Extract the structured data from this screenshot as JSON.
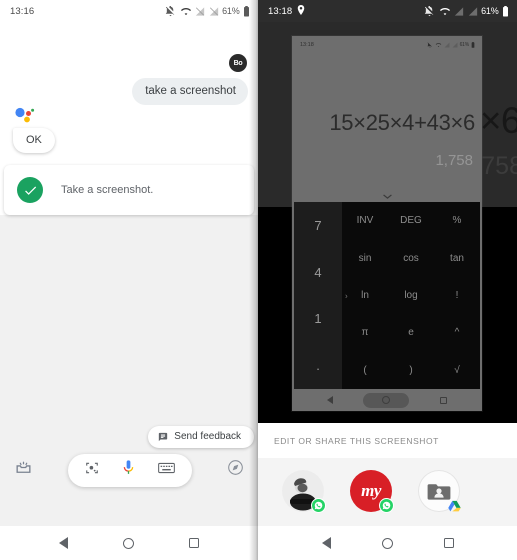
{
  "left_panel": {
    "status_bar": {
      "time": "13:16",
      "battery": "61%",
      "icons": [
        "notifications-off-icon",
        "wifi-icon",
        "signal-off-icon",
        "signal-off-icon",
        "battery-icon"
      ]
    },
    "avatar": {
      "initials": "Bo",
      "name": "account-avatar"
    },
    "user_message": "take a screenshot",
    "assistant_reply": "OK",
    "result_card": {
      "text": "Take a screenshot.",
      "status": "success",
      "accent_color": "#1aa260"
    },
    "feedback_chip": {
      "label": "Send feedback",
      "icon": "feedback-icon"
    },
    "input_bar": {
      "lens_icon": "google-lens-icon",
      "mic_icon": "microphone-icon",
      "keyboard_icon": "keyboard-icon",
      "snapshot_icon": "snapshot-inbox-icon",
      "explore_icon": "compass-explore-icon"
    },
    "nav_bar": {
      "back": "back-icon",
      "home": "home-icon",
      "recents": "recents-icon"
    }
  },
  "right_panel": {
    "status_bar": {
      "time": "13:18",
      "battery": "61%",
      "location_icon": "location-pin-icon",
      "icons": [
        "notifications-off-icon",
        "wifi-icon",
        "signal-off-icon",
        "signal-off-icon",
        "battery-icon"
      ]
    },
    "screenshot_preview": {
      "status_bar": {
        "time": "13:18",
        "battery": "61%"
      },
      "calculator": {
        "expression": "15×25×4+43×6",
        "result": "1,758",
        "expander_icon": "chevron-down-icon",
        "number_column": [
          "7",
          "4",
          "1",
          "."
        ],
        "scientific_rows": [
          [
            "INV",
            "DEG",
            "%"
          ],
          [
            "sin",
            "cos",
            "tan"
          ],
          [
            "ln",
            "log",
            "!"
          ],
          [
            "π",
            "e",
            "^"
          ],
          [
            "(",
            ")",
            "√"
          ]
        ],
        "pager_arrow": "›"
      },
      "nav_bar": {
        "back": "back-icon",
        "home": "home-icon",
        "recents": "recents-icon"
      }
    },
    "background_calculator": {
      "expression_tail": "×6",
      "result_tail": "758"
    },
    "share_sheet": {
      "title": "EDIT OR SHARE THIS SCREENSHOT",
      "targets": [
        {
          "name": "whatsapp-contact",
          "label": "",
          "badge": "whatsapp-badge"
        },
        {
          "name": "makemytrip-contact",
          "label": "my",
          "badge": "whatsapp-badge"
        },
        {
          "name": "drive-folder",
          "label": "",
          "badge": "google-drive-badge"
        }
      ]
    },
    "nav_bar": {
      "back": "back-icon",
      "home": "home-icon",
      "recents": "recents-icon"
    }
  }
}
